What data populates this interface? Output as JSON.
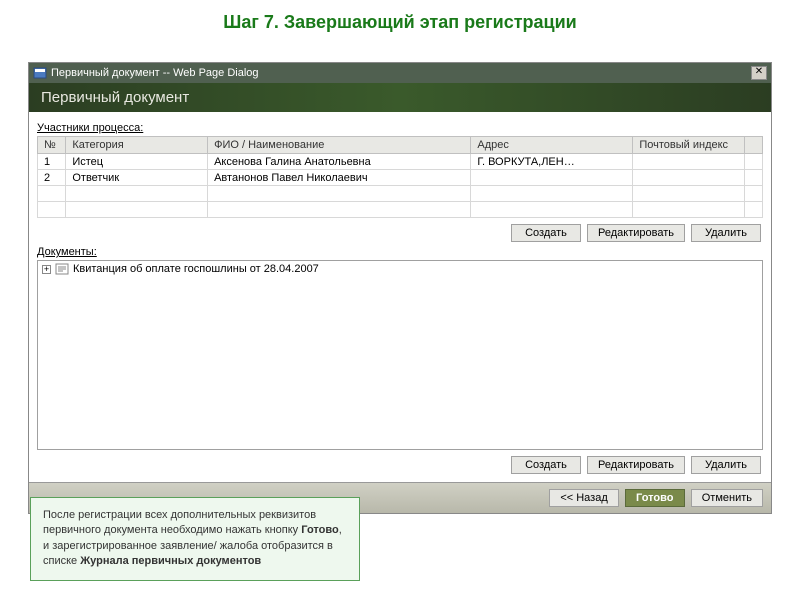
{
  "heading": "Шаг 7. Завершающий этап регистрации",
  "window": {
    "title": "Первичный документ -- Web Page Dialog",
    "subtitle": "Первичный документ"
  },
  "participants": {
    "label": "Участники процесса:",
    "headers": {
      "num": "№",
      "category": "Категория",
      "fio": "ФИО / Наименование",
      "address": "Адрес",
      "zip": "Почтовый индекс"
    },
    "rows": [
      {
        "num": "1",
        "category": "Истец",
        "fio": "Аксенова Галина Анатольевна",
        "address": "Г. ВОРКУТА,ЛЕН…",
        "zip": ""
      },
      {
        "num": "2",
        "category": "Ответчик",
        "fio": "Автанонов Павел Николаевич",
        "address": "",
        "zip": ""
      }
    ],
    "buttons": {
      "create": "Создать",
      "edit": "Редактировать",
      "del": "Удалить"
    }
  },
  "documents": {
    "label": "Документы:",
    "items": [
      {
        "text": "Квитанция об оплате госпошлины от 28.04.2007"
      }
    ],
    "buttons": {
      "create": "Создать",
      "edit": "Редактировать",
      "del": "Удалить"
    }
  },
  "footer": {
    "back": "<< Назад",
    "done": "Готово",
    "cancel": "Отменить"
  },
  "note": {
    "line1": "После регистрации всех дополнительных реквизитов первичного документа необходимо нажать кнопку ",
    "bold1": "Готово",
    "line2": ", и зарегистрированное  заявление/ жалоба отобразится в списке ",
    "bold2": "Журнала первичных  документов"
  }
}
